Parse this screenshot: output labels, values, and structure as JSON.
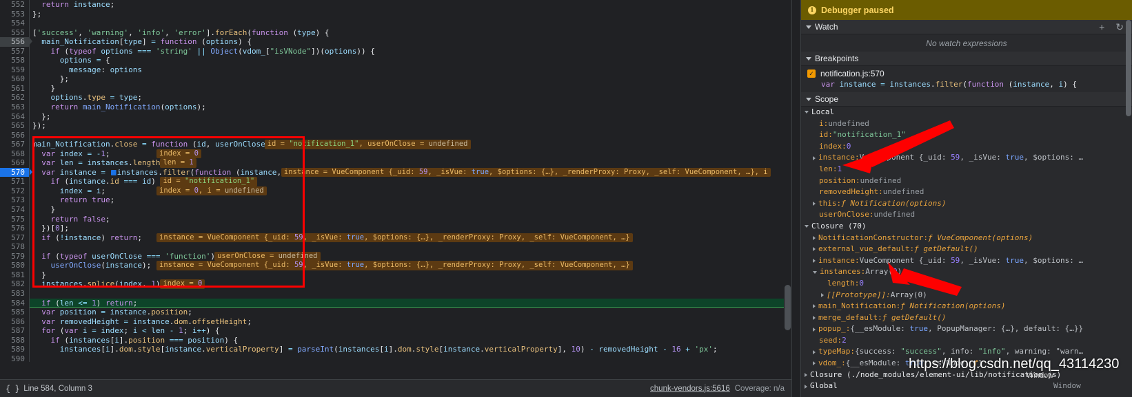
{
  "colors": {
    "editor_bg": "#202124",
    "panel_bg": "#292a2d",
    "paused_banner_bg": "#6b5c00",
    "paused_banner_fg": "#fdd663",
    "exec_line_bg": "#0d4429",
    "breakpoint_blue": "#1a73e8",
    "annotation_red": "#fe0000",
    "inline_value_bg": "#5c3a12",
    "inline_value_fg": "#e8b866"
  },
  "editor": {
    "first_line": 552,
    "current_line": 556,
    "breakpoint_line": 570,
    "execution_line": 584,
    "lines": [
      {
        "n": 552,
        "text": "  return instance;"
      },
      {
        "n": 553,
        "text": "};"
      },
      {
        "n": 554,
        "text": ""
      },
      {
        "n": 555,
        "text": "['success', 'warning', 'info', 'error'].forEach(function (type) {"
      },
      {
        "n": 556,
        "text": "  main_Notification[type] = function (options) {"
      },
      {
        "n": 557,
        "text": "    if (typeof options === 'string' || Object(vdom_[\"isVNode\"])(options)) {"
      },
      {
        "n": 558,
        "text": "      options = {"
      },
      {
        "n": 559,
        "text": "        message: options"
      },
      {
        "n": 560,
        "text": "      };"
      },
      {
        "n": 561,
        "text": "    }"
      },
      {
        "n": 562,
        "text": "    options.type = type;"
      },
      {
        "n": 563,
        "text": "    return main_Notification(options);"
      },
      {
        "n": 564,
        "text": "  };"
      },
      {
        "n": 565,
        "text": "});"
      },
      {
        "n": 566,
        "text": ""
      },
      {
        "n": 567,
        "text": "main_Notification.close = function (id, userOnClose) {",
        "value": "id = \"notification_1\", userOnClose = undefined"
      },
      {
        "n": 568,
        "text": "  var index = -1;",
        "value": "index = 0"
      },
      {
        "n": 569,
        "text": "  var len = instances.length;",
        "value": "len = 1"
      },
      {
        "n": 570,
        "text": "  var instance = instances.filter(function (instance, i) {",
        "value": "instance = VueComponent {_uid: 59, _isVue: true, $options: {…}, _renderProxy: Proxy, _self: VueComponent, …}, i"
      },
      {
        "n": 571,
        "text": "    if (instance.id === id) {",
        "value": "id = \"notification_1\""
      },
      {
        "n": 572,
        "text": "      index = i;",
        "value": "index = 0, i = undefined"
      },
      {
        "n": 573,
        "text": "      return true;"
      },
      {
        "n": 574,
        "text": "    }"
      },
      {
        "n": 575,
        "text": "    return false;"
      },
      {
        "n": 576,
        "text": "  })[0];"
      },
      {
        "n": 577,
        "text": "  if (!instance) return;",
        "value": "instance = VueComponent {_uid: 59, _isVue: true, $options: {…}, _renderProxy: Proxy, _self: VueComponent, …}"
      },
      {
        "n": 578,
        "text": ""
      },
      {
        "n": 579,
        "text": "  if (typeof userOnClose === 'function') {",
        "value": "userOnClose = undefined"
      },
      {
        "n": 580,
        "text": "    userOnClose(instance);",
        "value": "instance = VueComponent {_uid: 59, _isVue: true, $options: {…}, _renderProxy: Proxy, _self: VueComponent, …}"
      },
      {
        "n": 581,
        "text": "  }"
      },
      {
        "n": 582,
        "text": "  instances.splice(index, 1);",
        "value": "index = 0"
      },
      {
        "n": 583,
        "text": ""
      },
      {
        "n": 584,
        "text": "  if (len <= 1) return;"
      },
      {
        "n": 585,
        "text": "  var position = instance.position;"
      },
      {
        "n": 586,
        "text": "  var removedHeight = instance.dom.offsetHeight;"
      },
      {
        "n": 587,
        "text": "  for (var i = index; i < len - 1; i++) {"
      },
      {
        "n": 588,
        "text": "    if (instances[i].position === position) {"
      },
      {
        "n": 589,
        "text": "      instances[i].dom.style[instance.verticalProperty] = parseInt(instances[i].dom.style[instance.verticalProperty], 10) - removedHeight - 16 + 'px';"
      },
      {
        "n": 590,
        "text": ""
      }
    ]
  },
  "status_bar": {
    "pretty_print_icon": "{ }",
    "cursor_position": "Line 584, Column 3",
    "source_link": "chunk-vendors.js:5616",
    "coverage": "Coverage: n/a"
  },
  "debug_panel": {
    "paused_banner": {
      "icon": "info-icon",
      "text": "Debugger paused"
    },
    "watch": {
      "title": "Watch",
      "add_icon": "plus-icon",
      "refresh_icon": "refresh-icon",
      "empty_text": "No watch expressions"
    },
    "breakpoints": {
      "title": "Breakpoints",
      "items": [
        {
          "checked": true,
          "location": "notification.js:570",
          "snippet": "var instance = instances.filter(function (instance, i) {"
        }
      ]
    },
    "scope": {
      "title": "Scope",
      "groups": [
        {
          "name": "Local",
          "expanded": true,
          "entries": [
            {
              "indent": 1,
              "expand": "none",
              "name": "i",
              "value": "undefined",
              "kind": "undef"
            },
            {
              "indent": 1,
              "expand": "none",
              "name": "id",
              "value": "\"notification_1\"",
              "kind": "string"
            },
            {
              "indent": 1,
              "expand": "none",
              "name": "index",
              "value": "0",
              "kind": "number"
            },
            {
              "indent": 1,
              "expand": "right",
              "name": "instance",
              "value": "VueComponent {_uid: 59, _isVue: true, $options: …",
              "kind": "object"
            },
            {
              "indent": 1,
              "expand": "none",
              "name": "len",
              "value": "1",
              "kind": "number"
            },
            {
              "indent": 1,
              "expand": "none",
              "name": "position",
              "value": "undefined",
              "kind": "undef"
            },
            {
              "indent": 1,
              "expand": "none",
              "name": "removedHeight",
              "value": "undefined",
              "kind": "undef"
            },
            {
              "indent": 1,
              "expand": "right",
              "name": "this",
              "value": "ƒ Notification(options)",
              "kind": "function"
            },
            {
              "indent": 1,
              "expand": "none",
              "name": "userOnClose",
              "value": "undefined",
              "kind": "undef"
            }
          ]
        },
        {
          "name": "Closure (70)",
          "expanded": true,
          "entries": [
            {
              "indent": 1,
              "expand": "right",
              "name": "NotificationConstructor",
              "value": "ƒ VueComponent(options)",
              "kind": "function"
            },
            {
              "indent": 1,
              "expand": "right",
              "name": "external_vue_default",
              "value": "ƒ getDefault()",
              "kind": "function"
            },
            {
              "indent": 1,
              "expand": "right",
              "name": "instance",
              "value": "VueComponent {_uid: 59, _isVue: true, $options: …",
              "kind": "object"
            },
            {
              "indent": 1,
              "expand": "down",
              "name": "instances",
              "value": "Array(0)",
              "kind": "object"
            },
            {
              "indent": 2,
              "expand": "none",
              "name": "length",
              "value": "0",
              "kind": "number"
            },
            {
              "indent": 2,
              "expand": "right",
              "name": "[[Prototype]]",
              "value": "Array(0)",
              "kind": "proto"
            },
            {
              "indent": 1,
              "expand": "right",
              "name": "main_Notification",
              "value": "ƒ Notification(options)",
              "kind": "function"
            },
            {
              "indent": 1,
              "expand": "right",
              "name": "merge_default",
              "value": "ƒ getDefault()",
              "kind": "function"
            },
            {
              "indent": 1,
              "expand": "right",
              "name": "popup_",
              "value": "{__esModule: true, PopupManager: {…}, default: {…}}",
              "kind": "object"
            },
            {
              "indent": 1,
              "expand": "none",
              "name": "seed",
              "value": "2",
              "kind": "number"
            },
            {
              "indent": 1,
              "expand": "right",
              "name": "typeMap",
              "value": "{success: \"success\", info: \"info\", warning: \"warn…",
              "kind": "object"
            },
            {
              "indent": 1,
              "expand": "right",
              "name": "vdom_",
              "value": "{__esModule: true, isVNode: ƒ}",
              "kind": "object"
            }
          ]
        },
        {
          "name": "Closure (./node_modules/element-ui/lib/notification.js)",
          "expanded": false,
          "entries": []
        },
        {
          "name": "Global",
          "expanded": false,
          "value": "Window",
          "entries": []
        }
      ]
    }
  },
  "annotations": {
    "red_rectangle": "highlight-box-closing-code",
    "arrow_1": "arrow-pointing-to-local-instance",
    "arrow_2": "arrow-pointing-to-closure-instances-array"
  },
  "watermark": {
    "url": "https://blog.csdn.net/qq_43114230",
    "corner_text": "Window"
  }
}
